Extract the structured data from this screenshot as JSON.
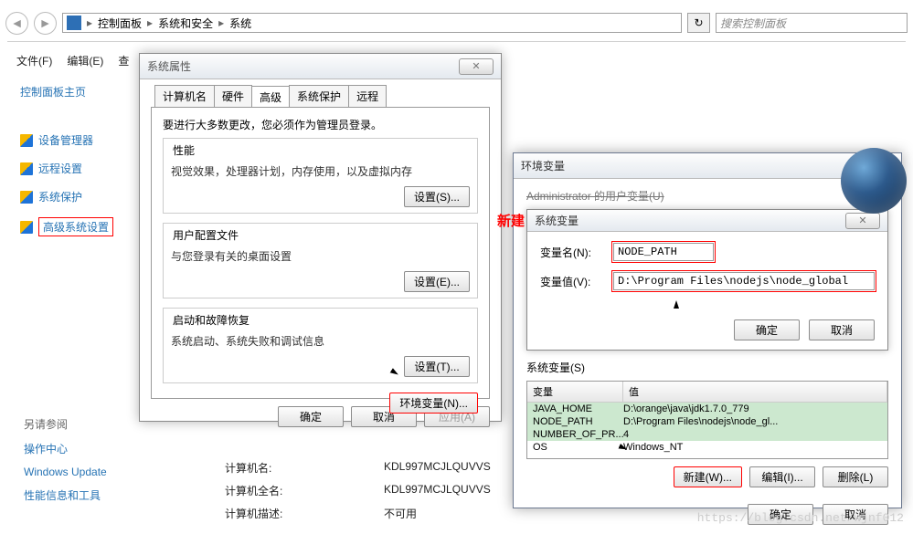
{
  "addressbar": {
    "crumbs": [
      "控制面板",
      "系统和安全",
      "系统"
    ],
    "sep": "▸",
    "refresh": "↻",
    "search_placeholder": "搜索控制面板"
  },
  "menubar": [
    "文件(F)",
    "编辑(E)",
    "查"
  ],
  "sidebar": {
    "home": "控制面板主页",
    "links": [
      "设备管理器",
      "远程设置",
      "系统保护",
      "高级系统设置"
    ]
  },
  "seealso": {
    "header": "另请参阅",
    "items": [
      "操作中心",
      "Windows Update",
      "性能信息和工具"
    ]
  },
  "compinfo": {
    "rows": [
      {
        "label": "计算机名:",
        "value": "KDL997MCJLQUVVS"
      },
      {
        "label": "计算机全名:",
        "value": "KDL997MCJLQUVVS"
      },
      {
        "label": "计算机描述:",
        "value": "不可用"
      }
    ]
  },
  "dlg1": {
    "title": "系统属性",
    "tabs": [
      "计算机名",
      "硬件",
      "高级",
      "系统保护",
      "远程"
    ],
    "active_tab": 2,
    "intro": "要进行大多数更改，您必须作为管理员登录。",
    "groups": [
      {
        "title": "性能",
        "desc": "视觉效果，处理器计划，内存使用，以及虚拟内存",
        "btn": "设置(S)..."
      },
      {
        "title": "用户配置文件",
        "desc": "与您登录有关的桌面设置",
        "btn": "设置(E)..."
      },
      {
        "title": "启动和故障恢复",
        "desc": "系统启动、系统失败和调试信息",
        "btn": "设置(T)..."
      }
    ],
    "env_btn": "环境变量(N)...",
    "ok": "确定",
    "cancel": "取消",
    "apply": "应用(A)"
  },
  "dlg2": {
    "title": "环境变量",
    "user_vars_prefix_striked": "Administrator 的用户变量(U)",
    "annotation": "新建",
    "sysvar_dlg_title": "系统变量",
    "form": {
      "name_label": "变量名(N):",
      "name_value": "NODE_PATH",
      "value_label": "变量值(V):",
      "value_value": "D:\\Program Files\\nodejs\\node_global"
    },
    "ok": "确定",
    "cancel": "取消",
    "sysvars_label": "系统变量(S)",
    "col_var": "变量",
    "col_val": "值",
    "vars": [
      {
        "name": "JAVA_HOME",
        "value": "D:\\orange\\java\\jdk1.7.0_779"
      },
      {
        "name": "NODE_PATH",
        "value": "D:\\Program Files\\nodejs\\node_gl..."
      },
      {
        "name": "NUMBER_OF_PR...",
        "value": "4"
      },
      {
        "name": "OS",
        "value": "Windows_NT"
      }
    ],
    "btn_new": "新建(W)...",
    "btn_edit": "编辑(I)...",
    "btn_del": "删除(L)"
  },
  "watermark": "https://blog.csdn.net/wjnf012",
  "icons": {
    "close_x": "✕",
    "back": "◄",
    "fwd": "►"
  }
}
